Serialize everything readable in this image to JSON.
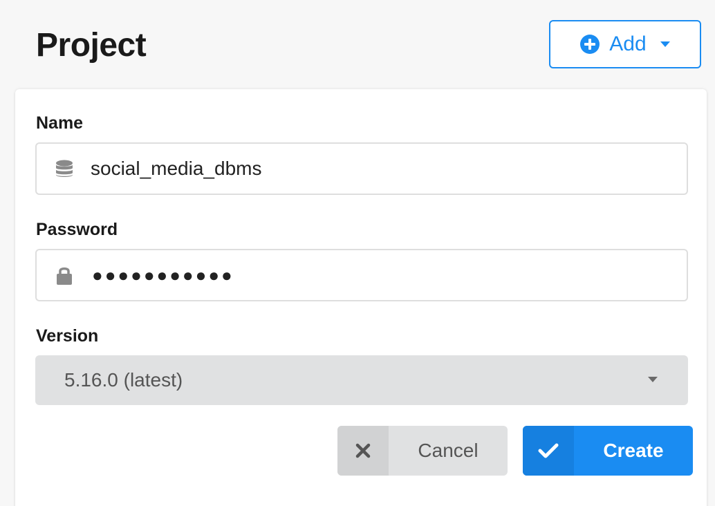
{
  "header": {
    "title": "Project",
    "add_button": {
      "label": "Add",
      "icon": "plus-circle-icon",
      "dropdown_icon": "caret-down-icon"
    }
  },
  "form": {
    "name": {
      "label": "Name",
      "value": "social_media_dbms",
      "icon": "database-icon"
    },
    "password": {
      "label": "Password",
      "masked_value": "●●●●●●●●●●●",
      "icon": "lock-icon"
    },
    "version": {
      "label": "Version",
      "selected": "5.16.0 (latest)",
      "icon": "caret-down-icon"
    },
    "actions": {
      "cancel_label": "Cancel",
      "cancel_icon": "close-icon",
      "create_label": "Create",
      "create_icon": "check-icon"
    }
  },
  "colors": {
    "accent": "#1a8cf2",
    "muted_button": "#e0e1e2",
    "border": "#dedede",
    "text": "#1f1f1f"
  }
}
